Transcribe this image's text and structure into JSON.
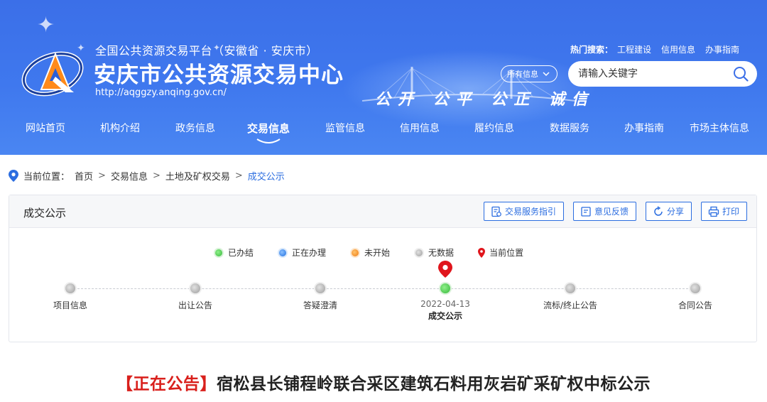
{
  "header": {
    "platform_line": "全国公共资源交易平台（安徽省 · 安庆市）",
    "title": "安庆市公共资源交易中心",
    "url": "http://aqggzy.anqing.gov.cn/",
    "slogan": "公开 公平 公正 诚信",
    "hot_label": "热门搜索：",
    "hot_links": [
      "工程建设",
      "信用信息",
      "办事指南"
    ],
    "scope": "所有信息",
    "search_placeholder": "请输入关键字"
  },
  "nav": [
    {
      "label": "网站首页",
      "active": false
    },
    {
      "label": "机构介绍",
      "active": false
    },
    {
      "label": "政务信息",
      "active": false
    },
    {
      "label": "交易信息",
      "active": true
    },
    {
      "label": "监管信息",
      "active": false
    },
    {
      "label": "信用信息",
      "active": false
    },
    {
      "label": "履约信息",
      "active": false
    },
    {
      "label": "数据服务",
      "active": false
    },
    {
      "label": "办事指南",
      "active": false
    },
    {
      "label": "市场主体信息",
      "active": false
    }
  ],
  "breadcrumb": {
    "prefix": "当前位置：",
    "items": [
      "首页",
      "交易信息",
      "土地及矿权交易",
      "成交公示"
    ],
    "sep": ">"
  },
  "panel": {
    "title": "成交公示",
    "tools": [
      "交易服务指引",
      "意见反馈",
      "分享",
      "打印"
    ],
    "legend": {
      "done": "已办结",
      "doing": "正在办理",
      "todo": "未开始",
      "none": "无数据",
      "current": "当前位置"
    },
    "steps": [
      {
        "label": "项目信息",
        "status": "none"
      },
      {
        "label": "出让公告",
        "status": "none"
      },
      {
        "label": "答疑澄清",
        "status": "none"
      },
      {
        "label": "成交公示",
        "status": "done",
        "date": "2022-04-13",
        "current": true
      },
      {
        "label": "流标/终止公告",
        "status": "none"
      },
      {
        "label": "合同公告",
        "status": "none"
      }
    ]
  },
  "notice": {
    "tag": "【正在公告】",
    "title": "宿松县长铺程岭联合采区建筑石料用灰岩矿采矿权中标公示"
  },
  "colors": {
    "banner": "#3f78ee",
    "accent": "#2b6de0",
    "tag_red": "#d9201c",
    "done_green": "#35b83a"
  }
}
